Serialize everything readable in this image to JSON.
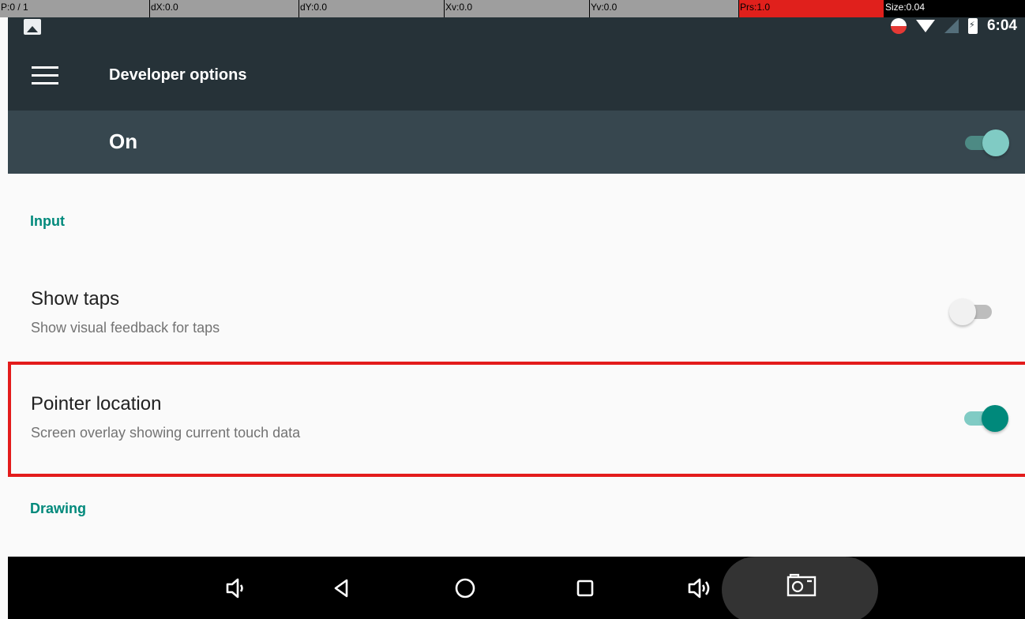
{
  "pointer_overlay": {
    "cells": [
      {
        "text": "P:0 / 1"
      },
      {
        "text": "dX:0.0"
      },
      {
        "text": "dY:0.0"
      },
      {
        "text": "Xv:0.0"
      },
      {
        "text": "Yv:0.0"
      },
      {
        "text": "Prs:1.0"
      },
      {
        "text": "Size:0.04"
      }
    ]
  },
  "status_bar": {
    "time": "6:04",
    "icons": [
      "image-notification-icon",
      "sync-circle-icon",
      "wifi-icon",
      "cell-signal-icon",
      "battery-charging-icon"
    ]
  },
  "toolbar": {
    "title": "Developer options",
    "menu_icon": "hamburger-menu-icon"
  },
  "master_switch": {
    "label": "On",
    "checked": true
  },
  "sections": {
    "input": {
      "title": "Input"
    },
    "drawing": {
      "title": "Drawing"
    }
  },
  "preferences": {
    "show_taps": {
      "title": "Show taps",
      "summary": "Show visual feedback for taps",
      "checked": false
    },
    "pointer_location": {
      "title": "Pointer location",
      "summary": "Screen overlay showing current touch data",
      "checked": true
    }
  },
  "navigation_bar": {
    "buttons": [
      "volume-down-icon",
      "back-icon",
      "home-icon",
      "recents-icon",
      "volume-up-icon",
      "screenshot-camera-icon"
    ]
  },
  "colors": {
    "accent": "#00897b",
    "accent_light": "#80cbc4",
    "toolbar": "#263238",
    "switch_bar": "#37474f",
    "highlight": "#e31b1b"
  }
}
